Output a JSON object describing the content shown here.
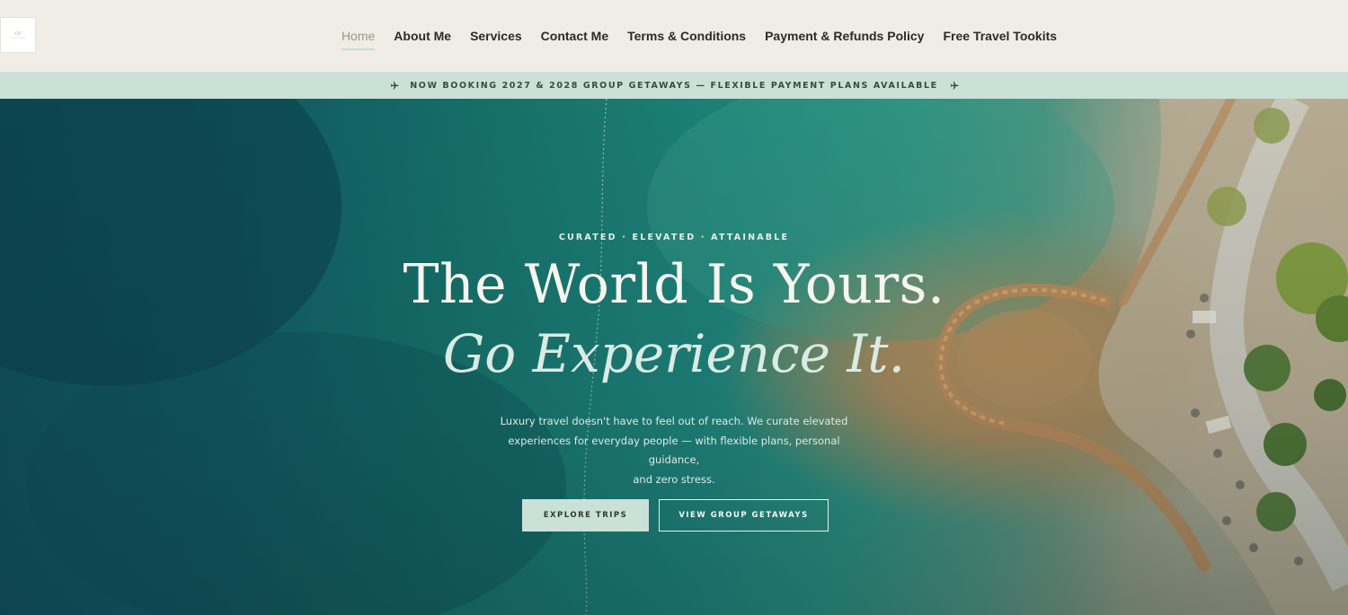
{
  "header": {
    "logo_text": "CF",
    "nav": [
      {
        "label": "Home",
        "active": true
      },
      {
        "label": "About Me",
        "active": false
      },
      {
        "label": "Services",
        "active": false
      },
      {
        "label": "Contact Me",
        "active": false
      },
      {
        "label": "Terms & Conditions",
        "active": false
      },
      {
        "label": "Payment & Refunds Policy",
        "active": false
      },
      {
        "label": "Free Travel Tookits",
        "active": false
      }
    ]
  },
  "announcement": {
    "text": "NOW BOOKING 2027 & 2028 GROUP GETAWAYS — FLEXIBLE PAYMENT PLANS AVAILABLE",
    "icon": "airplane-icon"
  },
  "hero": {
    "eyebrow": "CURATED · ELEVATED · ATTAINABLE",
    "headline": "The World Is Yours.",
    "subheadline": "Go Experience It.",
    "lead_lines": [
      "Luxury travel doesn't have to feel out of reach. We curate elevated",
      "experiences for everyday people — with flexible plans, personal guidance,",
      "and zero stress."
    ],
    "primary_cta": "EXPLORE TRIPS",
    "secondary_cta": "VIEW GROUP GETAWAYS"
  },
  "colors": {
    "background": "#efede6",
    "accent_mint": "#c9e1d7",
    "nav_active": "#9d9a86",
    "ocean_deep": "#0f4c57",
    "ocean_teal": "#1d8279"
  }
}
